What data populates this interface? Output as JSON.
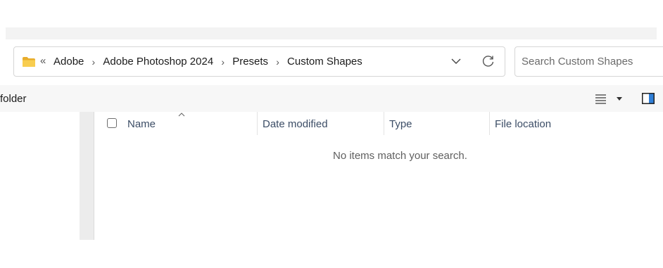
{
  "address_bar": {
    "overflow": "«",
    "breadcrumbs": [
      "Adobe",
      "Adobe Photoshop 2024",
      "Presets",
      "Custom Shapes"
    ],
    "separator": "›"
  },
  "search": {
    "placeholder": "Search Custom Shapes"
  },
  "toolbar": {
    "new_folder_label": "folder"
  },
  "columns": {
    "name": "Name",
    "date_modified": "Date modified",
    "type": "Type",
    "file_location": "File location"
  },
  "content": {
    "empty_message": "No items match your search."
  },
  "colors": {
    "folder_yellow": "#f5c342",
    "header_text": "#3c4d66",
    "pane_accent": "#2f7fd8"
  },
  "icons": [
    "folder-icon",
    "breadcrumb-chevron-icon",
    "dropdown-chevron-icon",
    "refresh-icon",
    "view-details-icon",
    "view-options-caret-icon",
    "preview-pane-icon",
    "sort-ascending-icon"
  ]
}
